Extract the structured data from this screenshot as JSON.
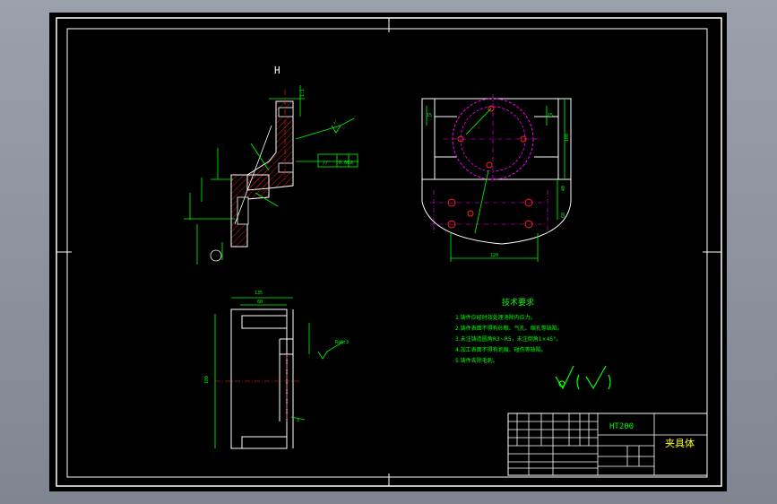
{
  "viewer": {
    "background": "#000000",
    "accent_green": "#00ff00",
    "accent_yellow": "#ffff00",
    "accent_magenta": "#ff00ff",
    "accent_red": "#ff2020",
    "frame": "#ffffff"
  },
  "section_mark": "H",
  "technical_requirements": {
    "title": "技术要求",
    "lines": [
      "1.铸件应经时效处理消除内应力。",
      "2.铸件表面不得有砂眼、气孔、缩孔等缺陷。",
      "3.未注铸造圆角R3~R5，未注倒角1×45°。",
      "4.加工表面不得有划痕、碰伤等缺陷。",
      "5.铸件去除毛刺。"
    ]
  },
  "roughness_note": "√ ( √ )",
  "title_block": {
    "material": "HT200",
    "part_name": "夹具体"
  }
}
